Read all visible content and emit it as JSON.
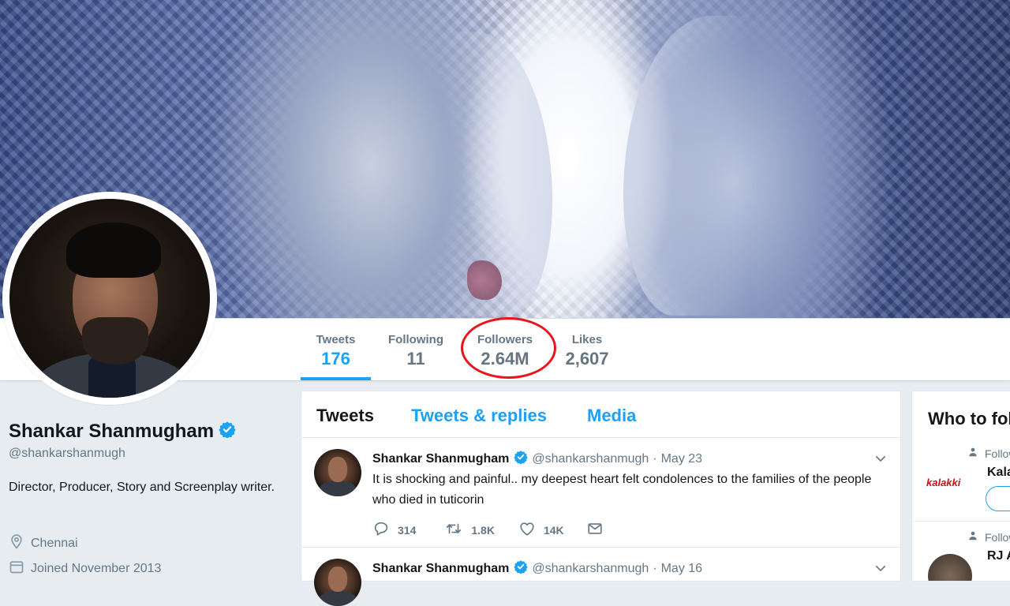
{
  "profile": {
    "name": "Shankar Shanmugham",
    "handle": "@shankarshanmugh",
    "bio": "Director, Producer, Story and Screenplay writer.",
    "location": "Chennai",
    "joined": "Joined November 2013"
  },
  "stats": {
    "tweets": {
      "label": "Tweets",
      "value": "176"
    },
    "following": {
      "label": "Following",
      "value": "11"
    },
    "followers": {
      "label": "Followers",
      "value": "2.64M"
    },
    "likes": {
      "label": "Likes",
      "value": "2,607"
    }
  },
  "timeline": {
    "tabs": [
      "Tweets",
      "Tweets & replies",
      "Media"
    ],
    "tweets": [
      {
        "name": "Shankar Shanmugham",
        "handle": "@shankarshanmugh",
        "date": "May 23",
        "text": "It is shocking and painful.. my deepest heart felt condolences to the families of the people who died in tuticorin",
        "replies": "314",
        "retweets": "1.8K",
        "likes": "14K"
      },
      {
        "name": "Shankar Shanmugham",
        "handle": "@shankarshanmugh",
        "date": "May 16"
      }
    ]
  },
  "who_to_follow": {
    "title": "Who to follow",
    "items": [
      {
        "follows_text": "Followed by",
        "name": "Kalakki",
        "logo_text": "kalakki"
      },
      {
        "follows_text": "Followed by",
        "name": "RJ Ananthi"
      }
    ]
  },
  "colors": {
    "accent": "#1da1f2",
    "highlight_ring": "#e8161b",
    "secondary_text": "#657786"
  },
  "icons": [
    "verified-badge-icon",
    "location-pin-icon",
    "calendar-icon",
    "reply-icon",
    "retweet-icon",
    "heart-icon",
    "direct-message-icon",
    "chevron-down-icon",
    "person-icon"
  ]
}
